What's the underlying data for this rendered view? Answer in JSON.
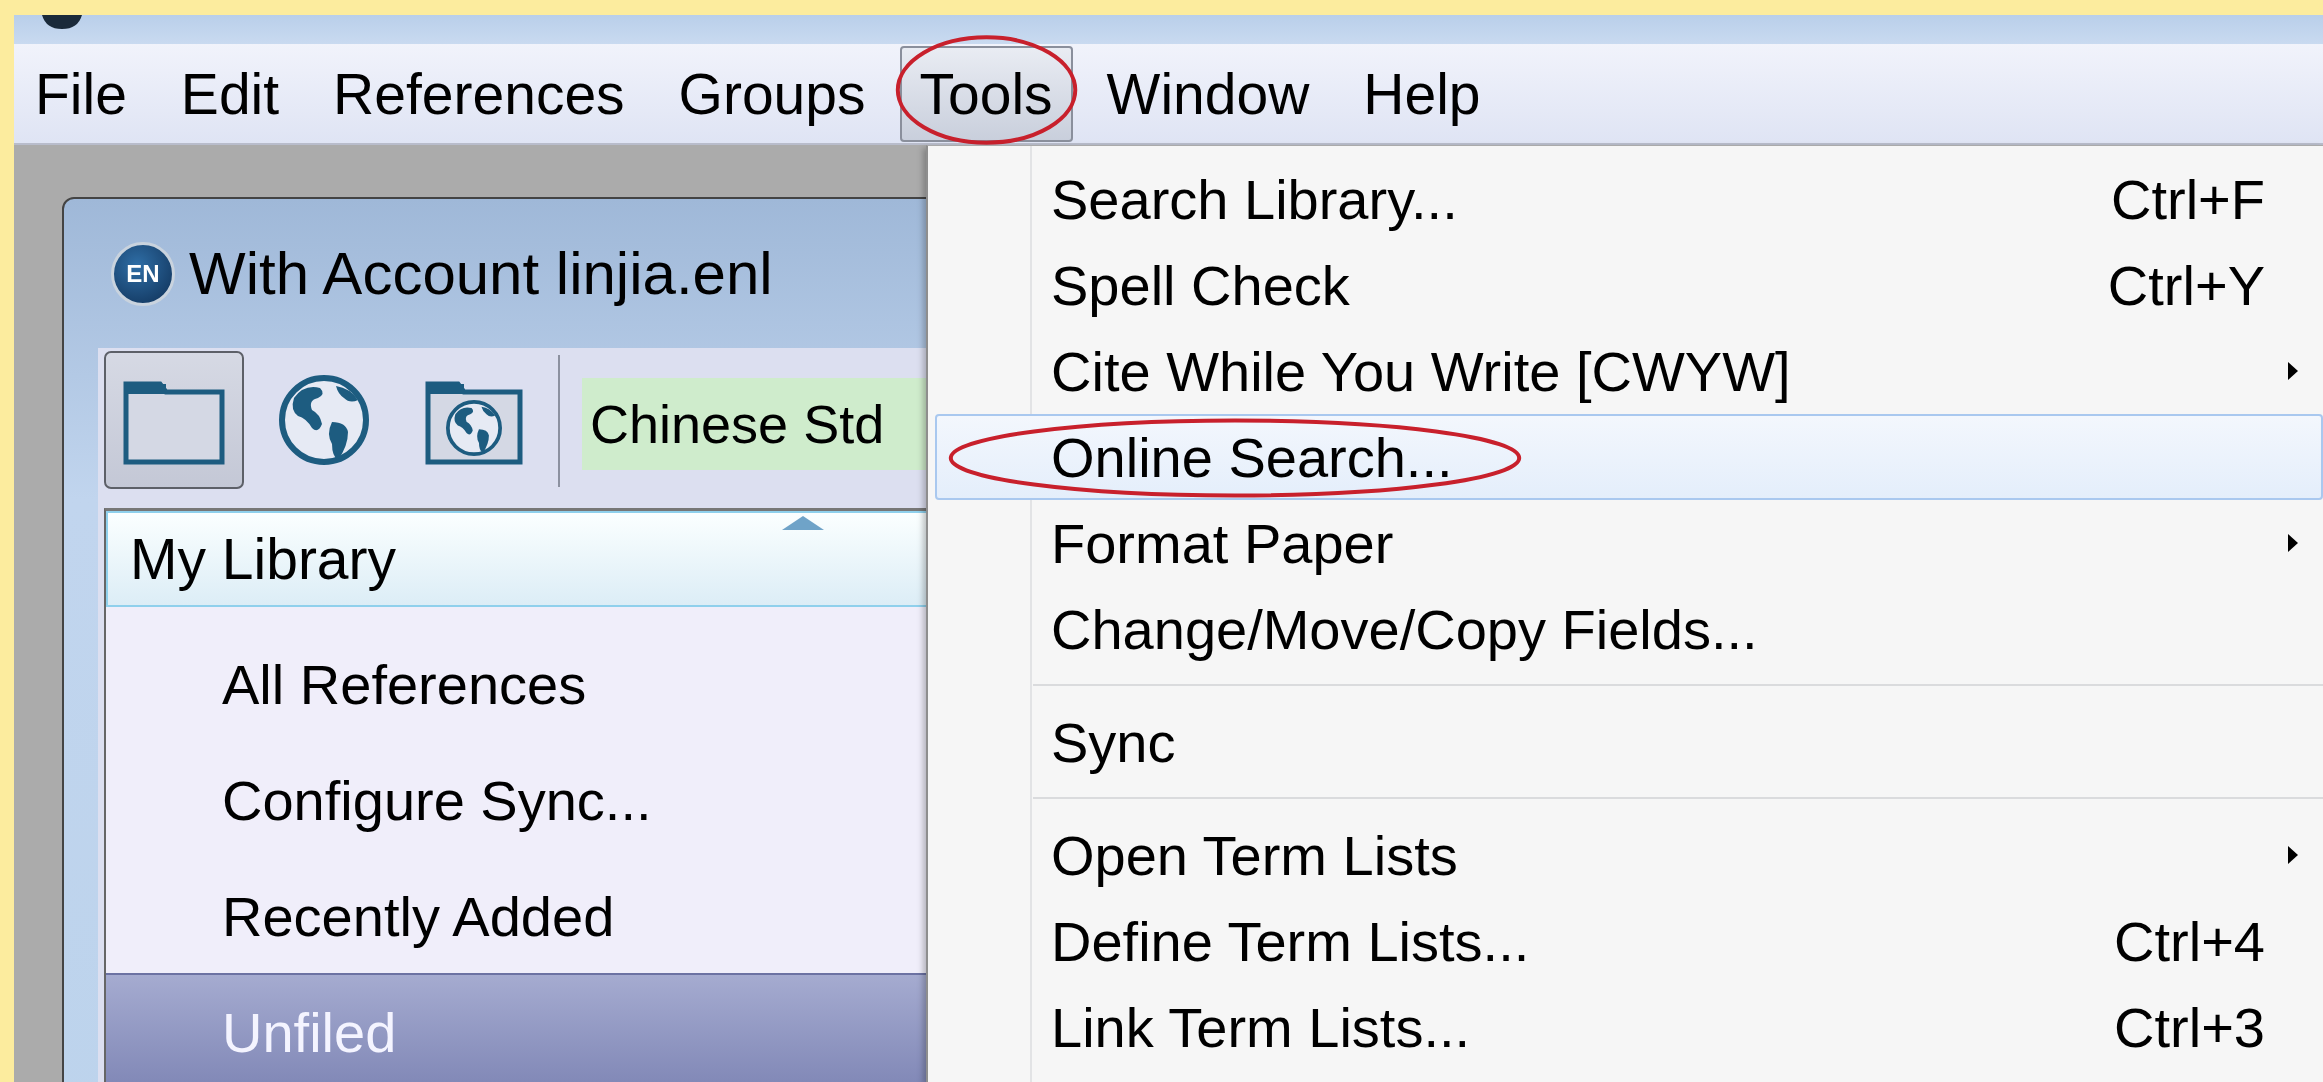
{
  "menubar": [
    {
      "label": "File",
      "selected": false,
      "circled": false
    },
    {
      "label": "Edit",
      "selected": false,
      "circled": false
    },
    {
      "label": "References",
      "selected": false,
      "circled": false
    },
    {
      "label": "Groups",
      "selected": false,
      "circled": false
    },
    {
      "label": "Tools",
      "selected": true,
      "circled": true
    },
    {
      "label": "Window",
      "selected": false,
      "circled": false
    },
    {
      "label": "Help",
      "selected": false,
      "circled": false
    }
  ],
  "library_window": {
    "badge": "EN",
    "title": "With Account linjia.enl",
    "toolbar": {
      "buttons": [
        {
          "kind": "folder",
          "selected": true
        },
        {
          "kind": "globe",
          "selected": false
        },
        {
          "kind": "folder-globe",
          "selected": false
        }
      ],
      "style_field": "Chinese Std"
    },
    "groups_panel": {
      "header": "My Library",
      "items": [
        {
          "label": "All References",
          "selected": false
        },
        {
          "label": "Configure Sync...",
          "selected": false
        },
        {
          "label": "Recently Added",
          "selected": false
        },
        {
          "label": "Unfiled",
          "selected": true
        }
      ]
    }
  },
  "menu": {
    "items": [
      {
        "kind": "item",
        "label": "Search Library...",
        "shortcut": "Ctrl+F",
        "submenu": false,
        "selected": false,
        "circled": false
      },
      {
        "kind": "item",
        "label": "Spell Check",
        "shortcut": "Ctrl+Y",
        "submenu": false,
        "selected": false,
        "circled": false
      },
      {
        "kind": "item",
        "label": "Cite While You Write [CWYW]",
        "submenu": true,
        "selected": false,
        "circled": false
      },
      {
        "kind": "item",
        "label": "Online Search...",
        "submenu": false,
        "selected": true,
        "circled": true
      },
      {
        "kind": "item",
        "label": "Format Paper",
        "submenu": true,
        "selected": false,
        "circled": false
      },
      {
        "kind": "item",
        "label": "Change/Move/Copy Fields...",
        "submenu": false,
        "selected": false,
        "circled": false
      },
      {
        "kind": "separator"
      },
      {
        "kind": "item",
        "label": "Sync",
        "submenu": false,
        "selected": false,
        "circled": false
      },
      {
        "kind": "separator"
      },
      {
        "kind": "item",
        "label": "Open Term Lists",
        "submenu": true,
        "selected": false,
        "circled": false
      },
      {
        "kind": "item",
        "label": "Define Term Lists...",
        "shortcut": "Ctrl+4",
        "submenu": false,
        "selected": false,
        "circled": false
      },
      {
        "kind": "item",
        "label": "Link Term Lists...",
        "shortcut": "Ctrl+3",
        "submenu": false,
        "selected": false,
        "circled": false
      }
    ]
  }
}
